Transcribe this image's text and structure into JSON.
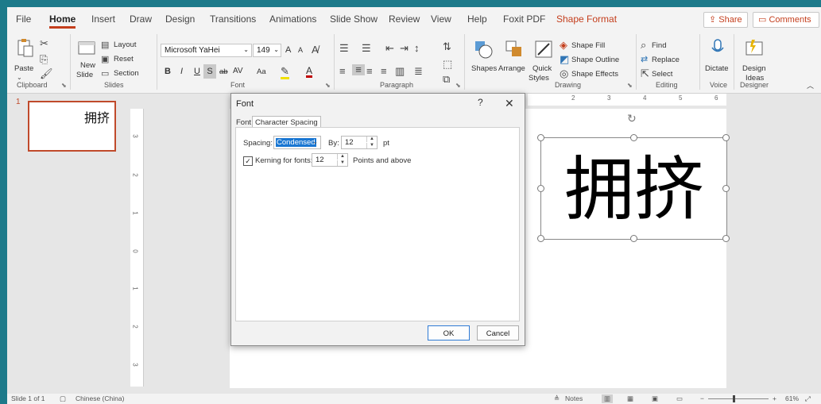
{
  "menu": {
    "tabs": [
      "File",
      "Home",
      "Insert",
      "Draw",
      "Design",
      "Transitions",
      "Animations",
      "Slide Show",
      "Review",
      "View",
      "Help",
      "Foxit PDF",
      "Shape Format"
    ],
    "share_label": "Share",
    "comments_label": "Comments"
  },
  "ribbon": {
    "clipboard": {
      "paste": "Paste",
      "label": "Clipboard"
    },
    "slides": {
      "new_slide": "New",
      "new_slide2": "Slide",
      "layout": "Layout",
      "reset": "Reset",
      "section": "Section",
      "label": "Slides"
    },
    "font": {
      "font_name": "Microsoft YaHei",
      "font_size": "149",
      "label": "Font",
      "bold": "B",
      "italic": "I",
      "underline": "U",
      "shadow": "S",
      "strike": "ab",
      "spacing": "AV",
      "case": "Aa",
      "grow": "A",
      "shrink": "A"
    },
    "paragraph": {
      "label": "Paragraph"
    },
    "drawing": {
      "shapes": "Shapes",
      "arrange": "Arrange",
      "quick": "Quick",
      "styles": "Styles",
      "fill": "Shape Fill",
      "outline": "Shape Outline",
      "effects": "Shape Effects",
      "label": "Drawing"
    },
    "editing": {
      "find": "Find",
      "replace": "Replace",
      "select": "Select",
      "label": "Editing"
    },
    "voice": {
      "dictate": "Dictate",
      "label": "Voice"
    },
    "designer": {
      "design": "Design",
      "ideas": "Ideas",
      "label": "Designer"
    }
  },
  "thumbnails": {
    "slide_number": "1",
    "text": "拥挤"
  },
  "ruler": {
    "vertical": [
      "3",
      "2",
      "1",
      "0",
      "1",
      "2",
      "3"
    ],
    "horizontal": [
      "2",
      "3",
      "4",
      "5",
      "6"
    ]
  },
  "slide": {
    "text": "拥挤"
  },
  "dialog": {
    "title": "Font",
    "help": "?",
    "close": "✕",
    "tab_font": "Font",
    "tab_char_spacing": "Character Spacing",
    "spacing_label": "Spacing:",
    "spacing_value": "Condensed",
    "by_label": "By:",
    "by_value": "12",
    "pt_label": "pt",
    "kerning_label": "Kerning for fonts:",
    "kerning_value": "12",
    "points_label": "Points and above",
    "ok": "OK",
    "cancel": "Cancel"
  },
  "status": {
    "slide_info": "Slide 1 of 1",
    "language": "Chinese (China)",
    "notes": "Notes",
    "zoom": "61%"
  },
  "colors": {
    "accent": "#c43e1c",
    "window_bg": "#1d7a8a"
  }
}
